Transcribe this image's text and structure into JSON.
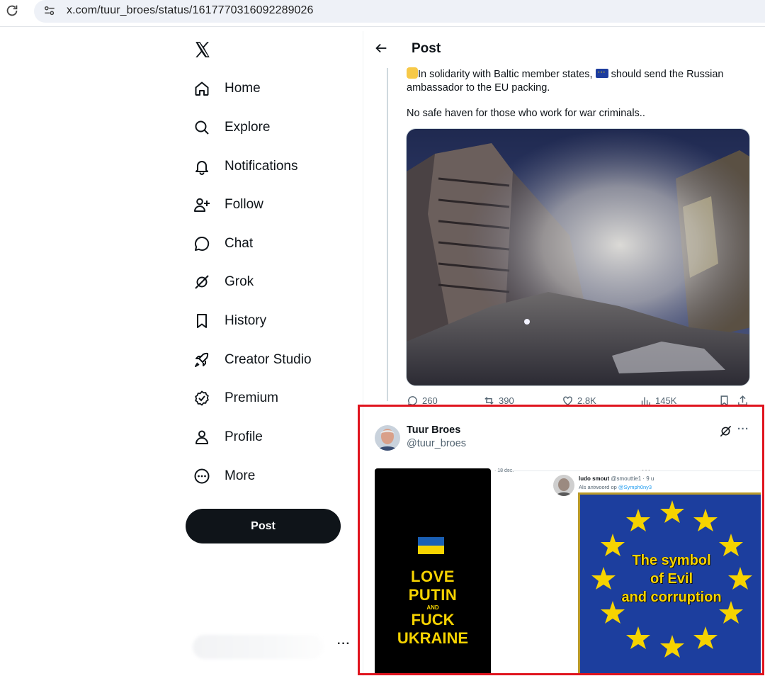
{
  "browser": {
    "url": "x.com/tuur_broes/status/1617770316092289026"
  },
  "sidebar": {
    "items": [
      {
        "label": "Home",
        "icon": "home-icon"
      },
      {
        "label": "Explore",
        "icon": "search-icon"
      },
      {
        "label": "Notifications",
        "icon": "bell-icon"
      },
      {
        "label": "Follow",
        "icon": "follow-icon"
      },
      {
        "label": "Chat",
        "icon": "chat-icon"
      },
      {
        "label": "Grok",
        "icon": "grok-icon"
      },
      {
        "label": "History",
        "icon": "bookmark-icon"
      },
      {
        "label": "Creator Studio",
        "icon": "rocket-icon"
      },
      {
        "label": "Premium",
        "icon": "verified-icon"
      },
      {
        "label": "Profile",
        "icon": "person-icon"
      },
      {
        "label": "More",
        "icon": "more-circle-icon"
      }
    ],
    "post_button": "Post",
    "account_more": "···"
  },
  "header": {
    "title": "Post"
  },
  "parent_tweet": {
    "line1": "In solidarity with Baltic member states,  should send the Russian ambassador to the EU packing.",
    "line2": "No safe haven for those who work for war criminals..",
    "stats": {
      "replies": "260",
      "reposts": "390",
      "likes": "2.8K",
      "views": "145K"
    }
  },
  "reply_tweet": {
    "author_name": "Tuur Broes",
    "author_handle": "@tuur_broes",
    "more": "···",
    "media": {
      "phone_line1": "LOVE",
      "phone_line2": "PUTIN",
      "phone_line3": "AND",
      "phone_line4": "FUCK",
      "phone_line5": "UKRAINE",
      "screenshot_date": "· 18 dec.",
      "screenshot_user": "ludo smout",
      "screenshot_handle": "@smouttie1 · 9 u",
      "screenshot_reply_prefix": "Als antwoord op ",
      "screenshot_reply_handle": "@Symph0ny3",
      "eu_line1": "The symbol",
      "eu_line2": "of Evil",
      "eu_line3": "and corruption"
    }
  },
  "colors": {
    "highlight": "#e0141e",
    "text": "#0f1419",
    "muted": "#536471",
    "eu_blue": "#1c3e9e",
    "yellow": "#f6d300"
  }
}
